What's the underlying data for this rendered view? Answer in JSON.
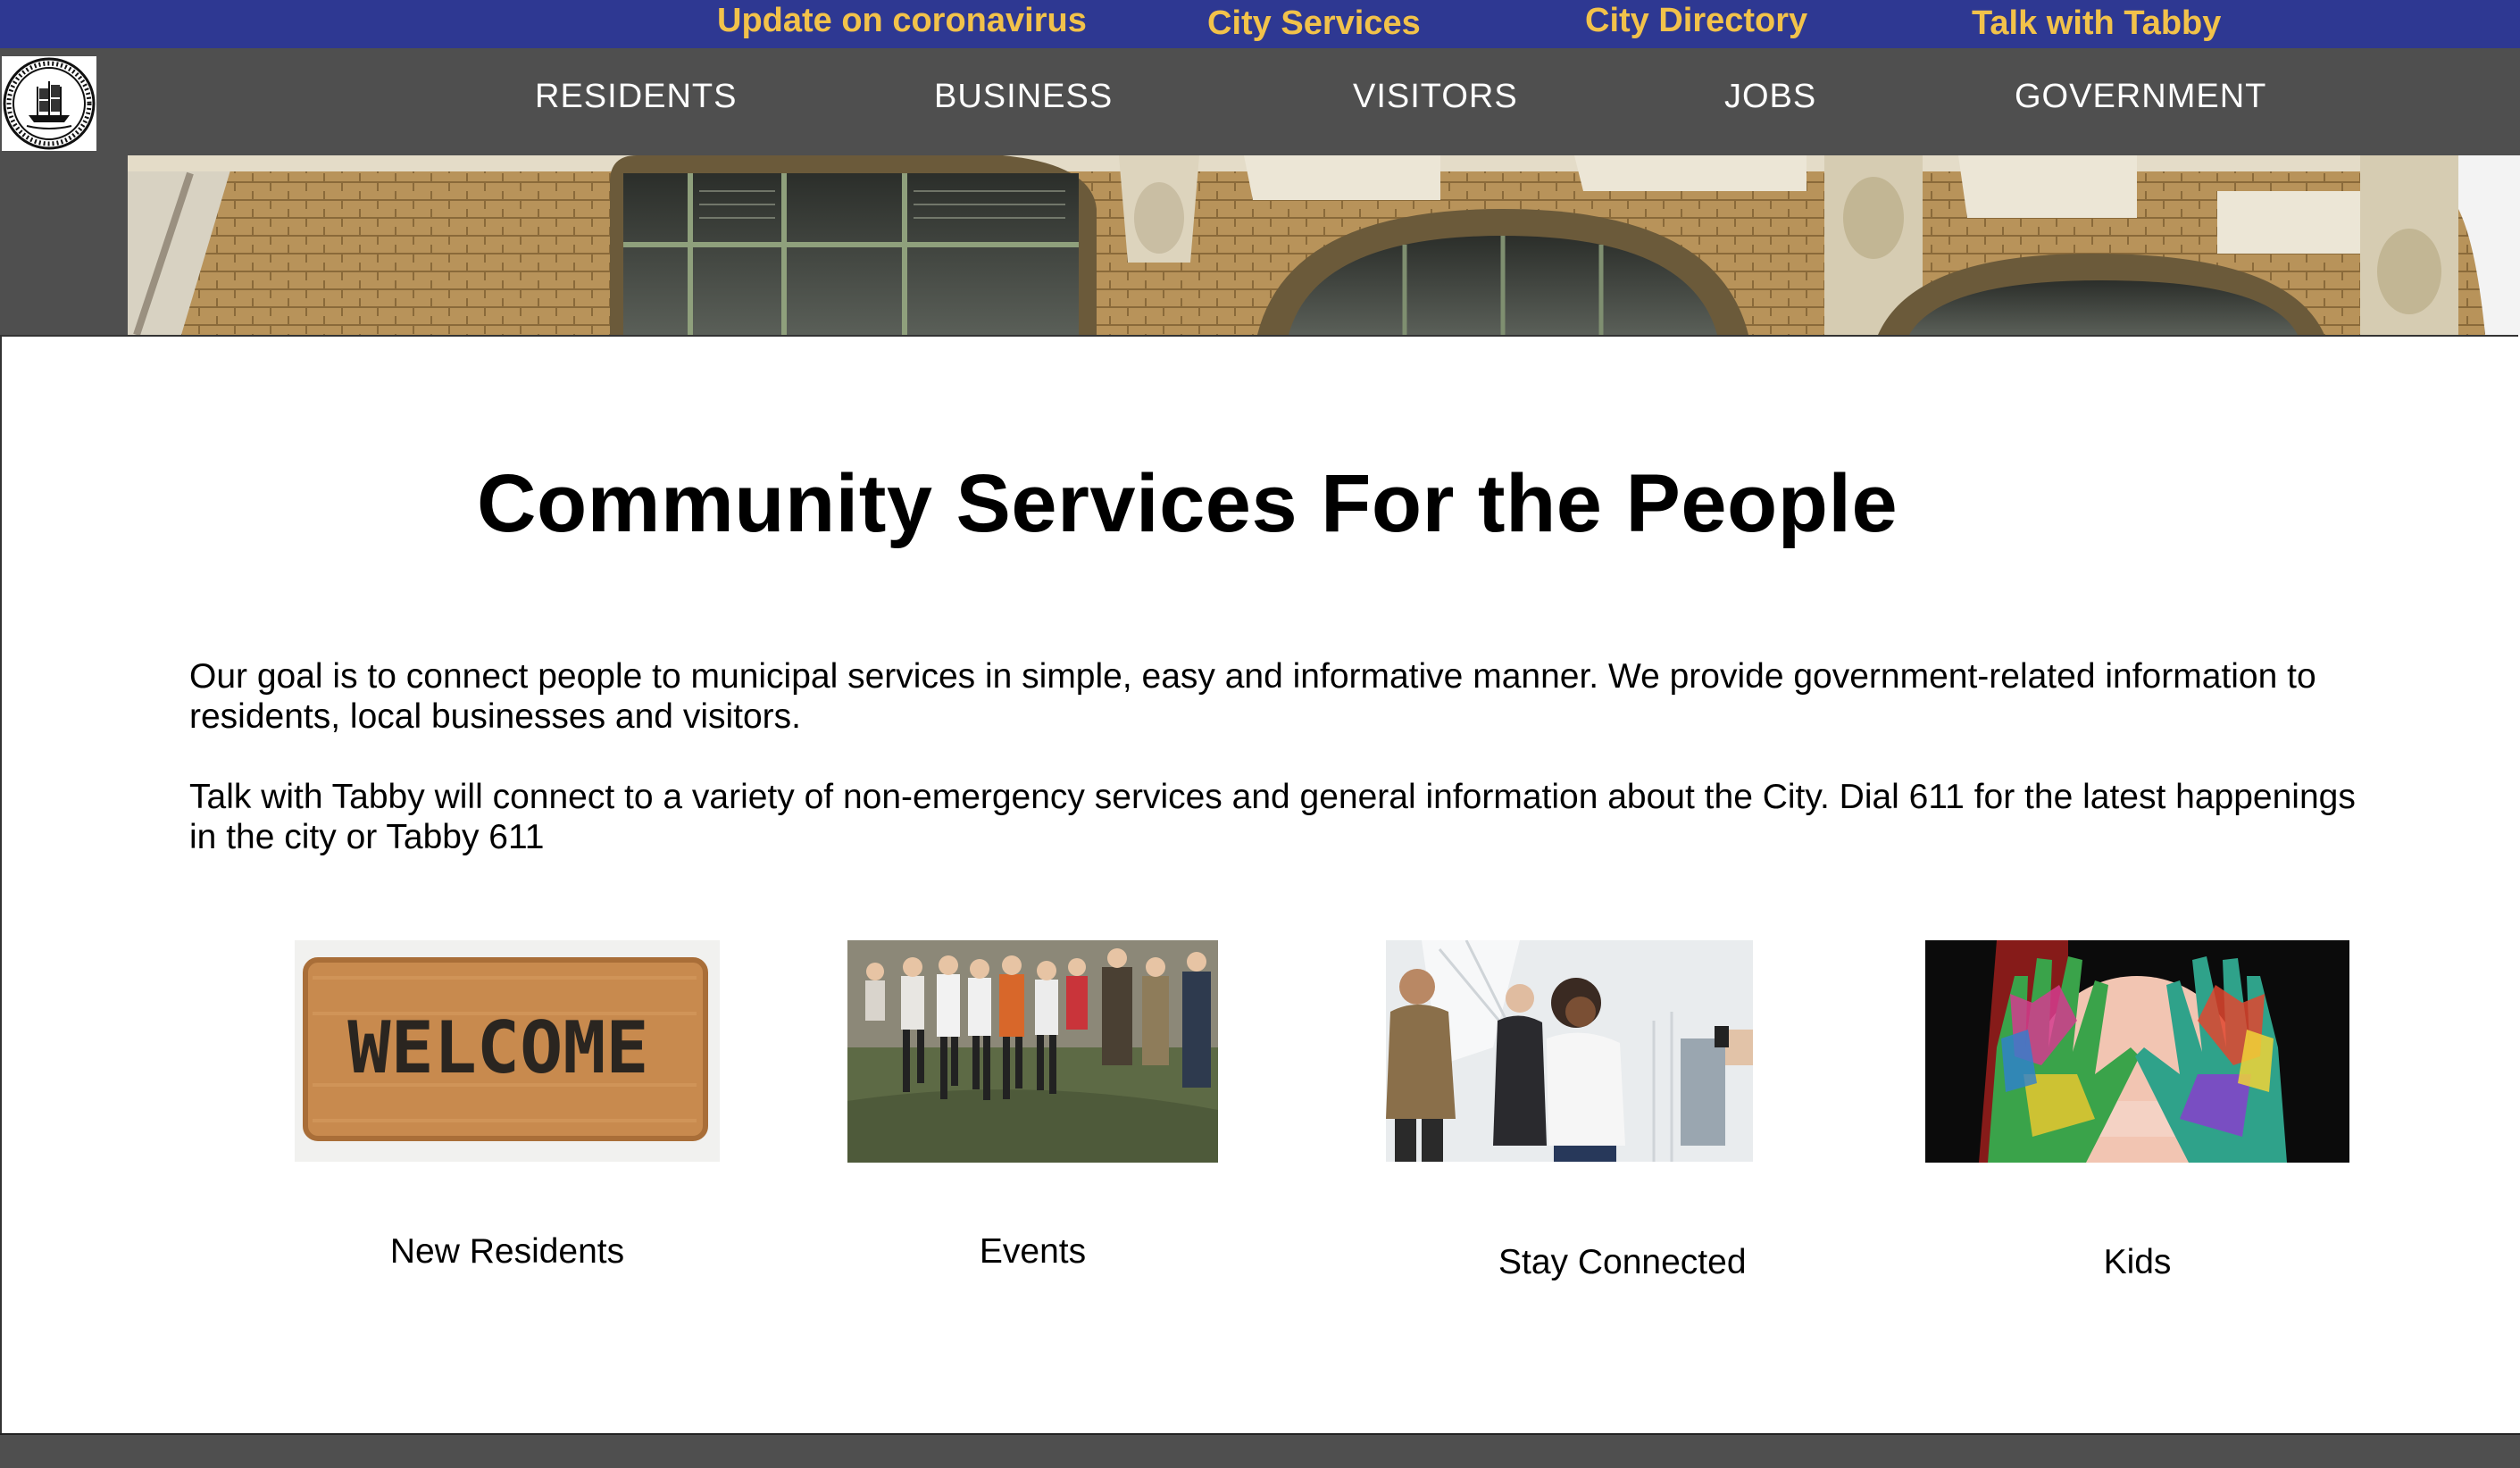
{
  "topbar": {
    "links": [
      "Update on coronavirus",
      "City Services",
      "City Directory",
      "Talk with Tabby"
    ]
  },
  "nav": {
    "seal_text": "CITY OF TAMPA FLORIDA",
    "items": [
      "RESIDENTS",
      "BUSINESS",
      "VISITORS",
      "JOBS",
      "GOVERNMENT"
    ]
  },
  "main": {
    "title": "Community Services For the People",
    "paragraph1": "Our goal is to connect people to municipal services in simple, easy and informative manner. We provide government-related information to residents, local businesses and visitors.",
    "paragraph2": "Talk with Tabby will connect to a variety of non-emergency services and general information about the City.  Dial 611 for the latest happenings in the city or Tabby 611",
    "cards": [
      {
        "label": "New Residents",
        "image_text": "WELCOME"
      },
      {
        "label": "Events"
      },
      {
        "label": "Stay Connected"
      },
      {
        "label": "Kids"
      }
    ]
  },
  "colors": {
    "topbar_bg": "#2e3892",
    "topbar_link": "#f2c24a",
    "nav_bg": "#4f4f4f",
    "nav_link": "#ffffff"
  }
}
